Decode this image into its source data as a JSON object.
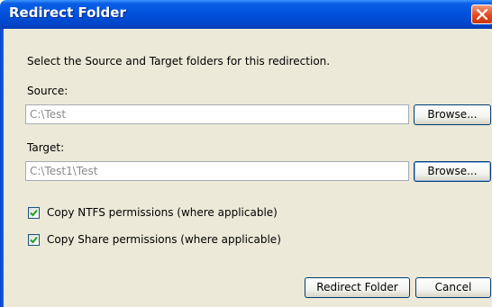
{
  "window": {
    "title": "Redirect Folder"
  },
  "dialog": {
    "instruction": "Select the Source and Target folders for this redirection.",
    "source": {
      "label": "Source:",
      "value": "C:\\Test",
      "browse_label": "Browse..."
    },
    "target": {
      "label": "Target:",
      "value": "C:\\Test1\\Test",
      "browse_label": "Browse..."
    },
    "options": [
      {
        "label": "Copy NTFS permissions (where applicable)",
        "checked": true
      },
      {
        "label": "Copy Share permissions (where applicable)",
        "checked": true
      }
    ],
    "buttons": {
      "redirect_label": "Redirect Folder",
      "cancel_label": "Cancel"
    }
  },
  "colors": {
    "titlebar": "#0050dc",
    "dialog_bg": "#ece9d8",
    "check": "#21a121"
  }
}
